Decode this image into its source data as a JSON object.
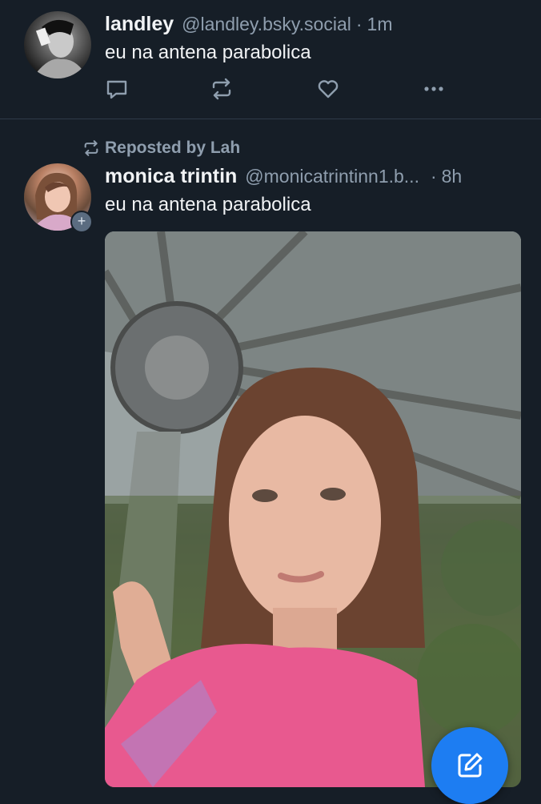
{
  "posts": [
    {
      "author_name": "landley",
      "author_handle": "@landley.bsky.social",
      "separator": "·",
      "time": "1m",
      "text": "eu na antena parabolica",
      "actions": [
        "reply-icon",
        "repost-icon",
        "like-icon",
        "more-icon"
      ]
    },
    {
      "repost_label": "Reposted by Lah",
      "author_name": "monica trintin",
      "author_handle": "@monicatrintinn1.b...",
      "separator": "·",
      "time": "8h",
      "text": "eu na antena parabolica",
      "follow_badge": "+",
      "image": "selfie-with-satellite-dish"
    }
  ],
  "fab": {
    "icon": "compose-icon"
  },
  "colors": {
    "background": "#161e27",
    "accent": "#1d7df2",
    "muted": "#8f9eae"
  }
}
